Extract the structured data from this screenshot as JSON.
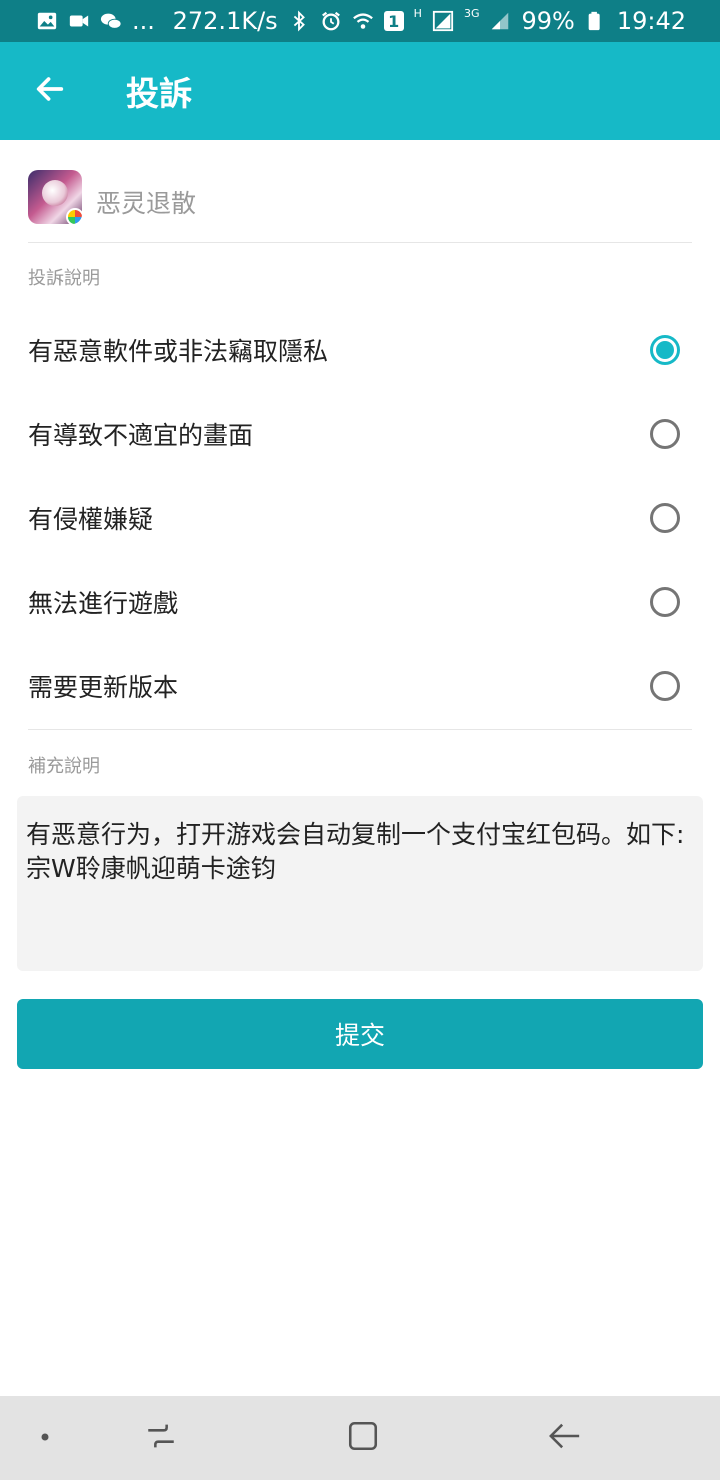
{
  "status_bar": {
    "network_speed": "272.1K/s",
    "sim_label": "1",
    "h_label": "H",
    "g_label": "3G",
    "battery": "99%",
    "time": "19:42",
    "ellipsis": "..."
  },
  "app_bar": {
    "title": "投訴"
  },
  "game": {
    "name": "恶灵退散"
  },
  "complaint_section": {
    "label": "投訴說明",
    "options": [
      {
        "label": "有惡意軟件或非法竊取隱私",
        "selected": true
      },
      {
        "label": "有導致不適宜的畫面",
        "selected": false
      },
      {
        "label": "有侵權嫌疑",
        "selected": false
      },
      {
        "label": "無法進行遊戲",
        "selected": false
      },
      {
        "label": "需要更新版本",
        "selected": false
      }
    ]
  },
  "supplement_section": {
    "label": "補充說明",
    "text": "有恶意行为，打开游戏会自动复制一个支付宝红包码。如下:宗W聆康帆迎萌卡途钧"
  },
  "submit": {
    "label": "提交"
  },
  "colors": {
    "status_bar": "#0e7f87",
    "app_bar": "#16b9c7",
    "accent": "#16b9c7",
    "button": "#12a6b2"
  }
}
